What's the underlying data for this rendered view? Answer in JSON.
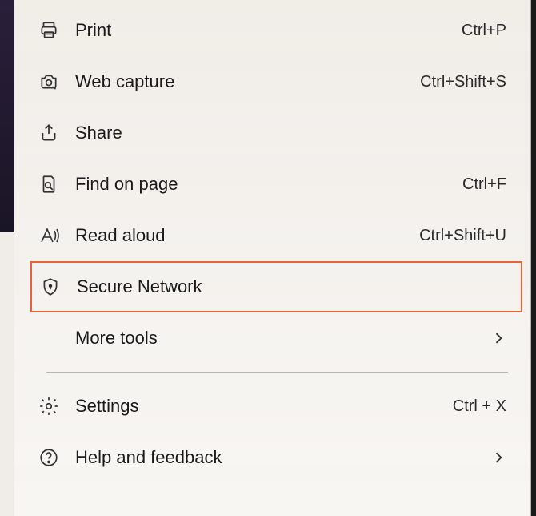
{
  "menu": {
    "items": [
      {
        "label": "Print",
        "shortcut": "Ctrl+P"
      },
      {
        "label": "Web capture",
        "shortcut": "Ctrl+Shift+S"
      },
      {
        "label": "Share",
        "shortcut": ""
      },
      {
        "label": "Find on page",
        "shortcut": "Ctrl+F"
      },
      {
        "label": "Read aloud",
        "shortcut": "Ctrl+Shift+U"
      },
      {
        "label": "Secure Network",
        "shortcut": ""
      },
      {
        "label": "More tools",
        "shortcut": ""
      },
      {
        "label": "Settings",
        "shortcut": "Ctrl + X"
      },
      {
        "label": "Help and feedback",
        "shortcut": ""
      }
    ]
  }
}
